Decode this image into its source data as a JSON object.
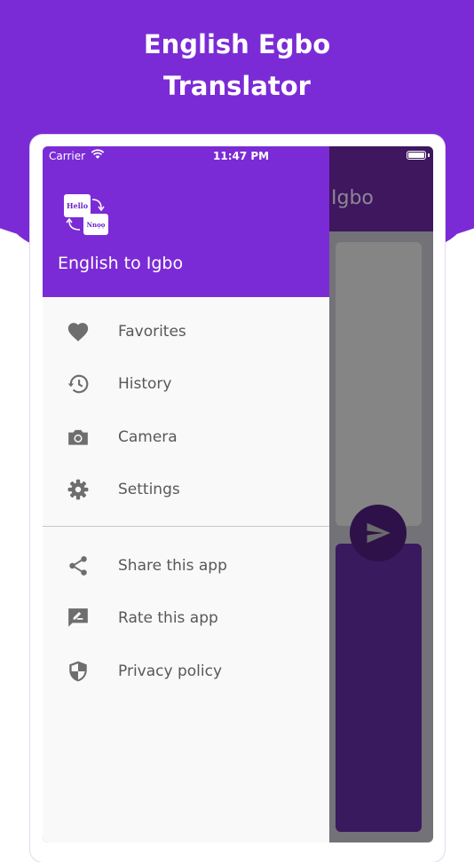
{
  "promo": {
    "headline_line1": "English Egbo",
    "headline_line2": "Translator"
  },
  "status_bar": {
    "carrier": "Carrier",
    "time": "11:47 PM"
  },
  "app": {
    "title_partial": "Igbo"
  },
  "drawer": {
    "logo_text_top": "Hello",
    "logo_text_bottom": "Nnọọ",
    "title": "English to Igbo",
    "items": [
      {
        "label": "Favorites",
        "icon": "heart-icon"
      },
      {
        "label": "History",
        "icon": "history-icon"
      },
      {
        "label": "Camera",
        "icon": "camera-icon"
      },
      {
        "label": "Settings",
        "icon": "gear-icon"
      }
    ],
    "secondary_items": [
      {
        "label": "Share this app",
        "icon": "share-icon"
      },
      {
        "label": "Rate this app",
        "icon": "rate-icon"
      },
      {
        "label": "Privacy policy",
        "icon": "shield-icon"
      }
    ]
  },
  "colors": {
    "brand_purple": "#7b2bd6",
    "dark_purple": "#3e175f",
    "icon_gray": "#6e6e6e"
  }
}
